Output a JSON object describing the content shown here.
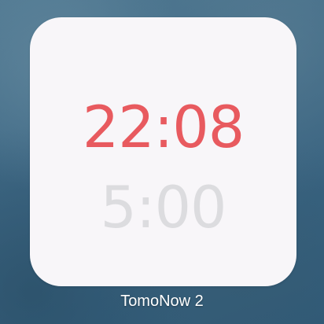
{
  "widget": {
    "time": "22:08",
    "timer": "5:00",
    "time_color": "#e85a5f",
    "timer_color": "#dcdcdf",
    "background_color": "#f8f6f9"
  },
  "app": {
    "name": "TomoNow 2"
  }
}
